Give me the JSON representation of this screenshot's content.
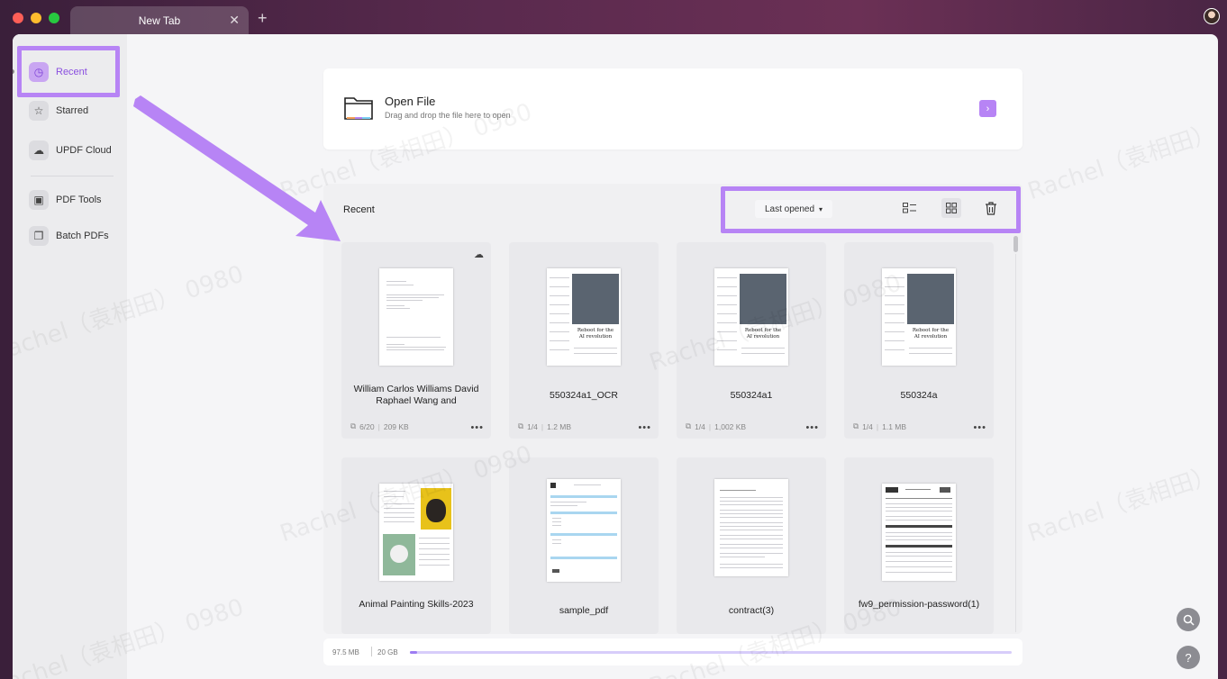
{
  "window": {
    "tab_title": "New Tab",
    "tab_close": "✕",
    "new_tab": "+"
  },
  "sidebar": {
    "items": [
      {
        "label": "Recent",
        "icon": "clock-icon",
        "glyph": "◷"
      },
      {
        "label": "Starred",
        "icon": "star-icon",
        "glyph": "☆"
      },
      {
        "label": "UPDF Cloud",
        "icon": "cloud-icon",
        "glyph": "☁"
      },
      {
        "label": "PDF Tools",
        "icon": "toolbox-icon",
        "glyph": "▣"
      },
      {
        "label": "Batch PDFs",
        "icon": "batch-icon",
        "glyph": "❐"
      }
    ]
  },
  "open_file": {
    "title": "Open File",
    "subtitle": "Drag and drop the file here to open",
    "arrow": "›"
  },
  "recent": {
    "title": "Recent",
    "sort_label": "Last opened",
    "sort_caret": "▾",
    "list_view_glyph": "☷",
    "grid_view_glyph": "⊞",
    "delete_glyph": "🗑",
    "files": [
      {
        "name": "William Carlos Williams David Raphael Wang and",
        "pages": "6/20",
        "size": "209 KB",
        "cloud": true
      },
      {
        "name": "550324a1_OCR",
        "pages": "1/4",
        "size": "1.2 MB",
        "cloud": false
      },
      {
        "name": "550324a1",
        "pages": "1/4",
        "size": "1,002 KB",
        "cloud": false
      },
      {
        "name": "550324a",
        "pages": "1/4",
        "size": "1.1 MB",
        "cloud": false
      },
      {
        "name": "Animal Painting Skills-2023",
        "pages": "",
        "size": "",
        "cloud": false
      },
      {
        "name": "sample_pdf",
        "pages": "",
        "size": "",
        "cloud": false
      },
      {
        "name": "contract(3)",
        "pages": "",
        "size": "",
        "cloud": false
      },
      {
        "name": "fw9_permission-password(1)",
        "pages": "",
        "size": "",
        "cloud": false
      }
    ],
    "article_headline": "Reboot for the AI revolution"
  },
  "storage": {
    "used": "97.5 MB",
    "total": "20 GB",
    "used_fraction": 0.005
  },
  "fabs": {
    "search_glyph": "⌕",
    "help_glyph": "?"
  },
  "more_glyph": "•••",
  "cloud_glyph": "☁",
  "copy_glyph": "⧉",
  "watermark_text": "Rachel（袁相田） 0980",
  "colors": {
    "accent": "#b784f5",
    "active_text": "#8a4fe0"
  }
}
